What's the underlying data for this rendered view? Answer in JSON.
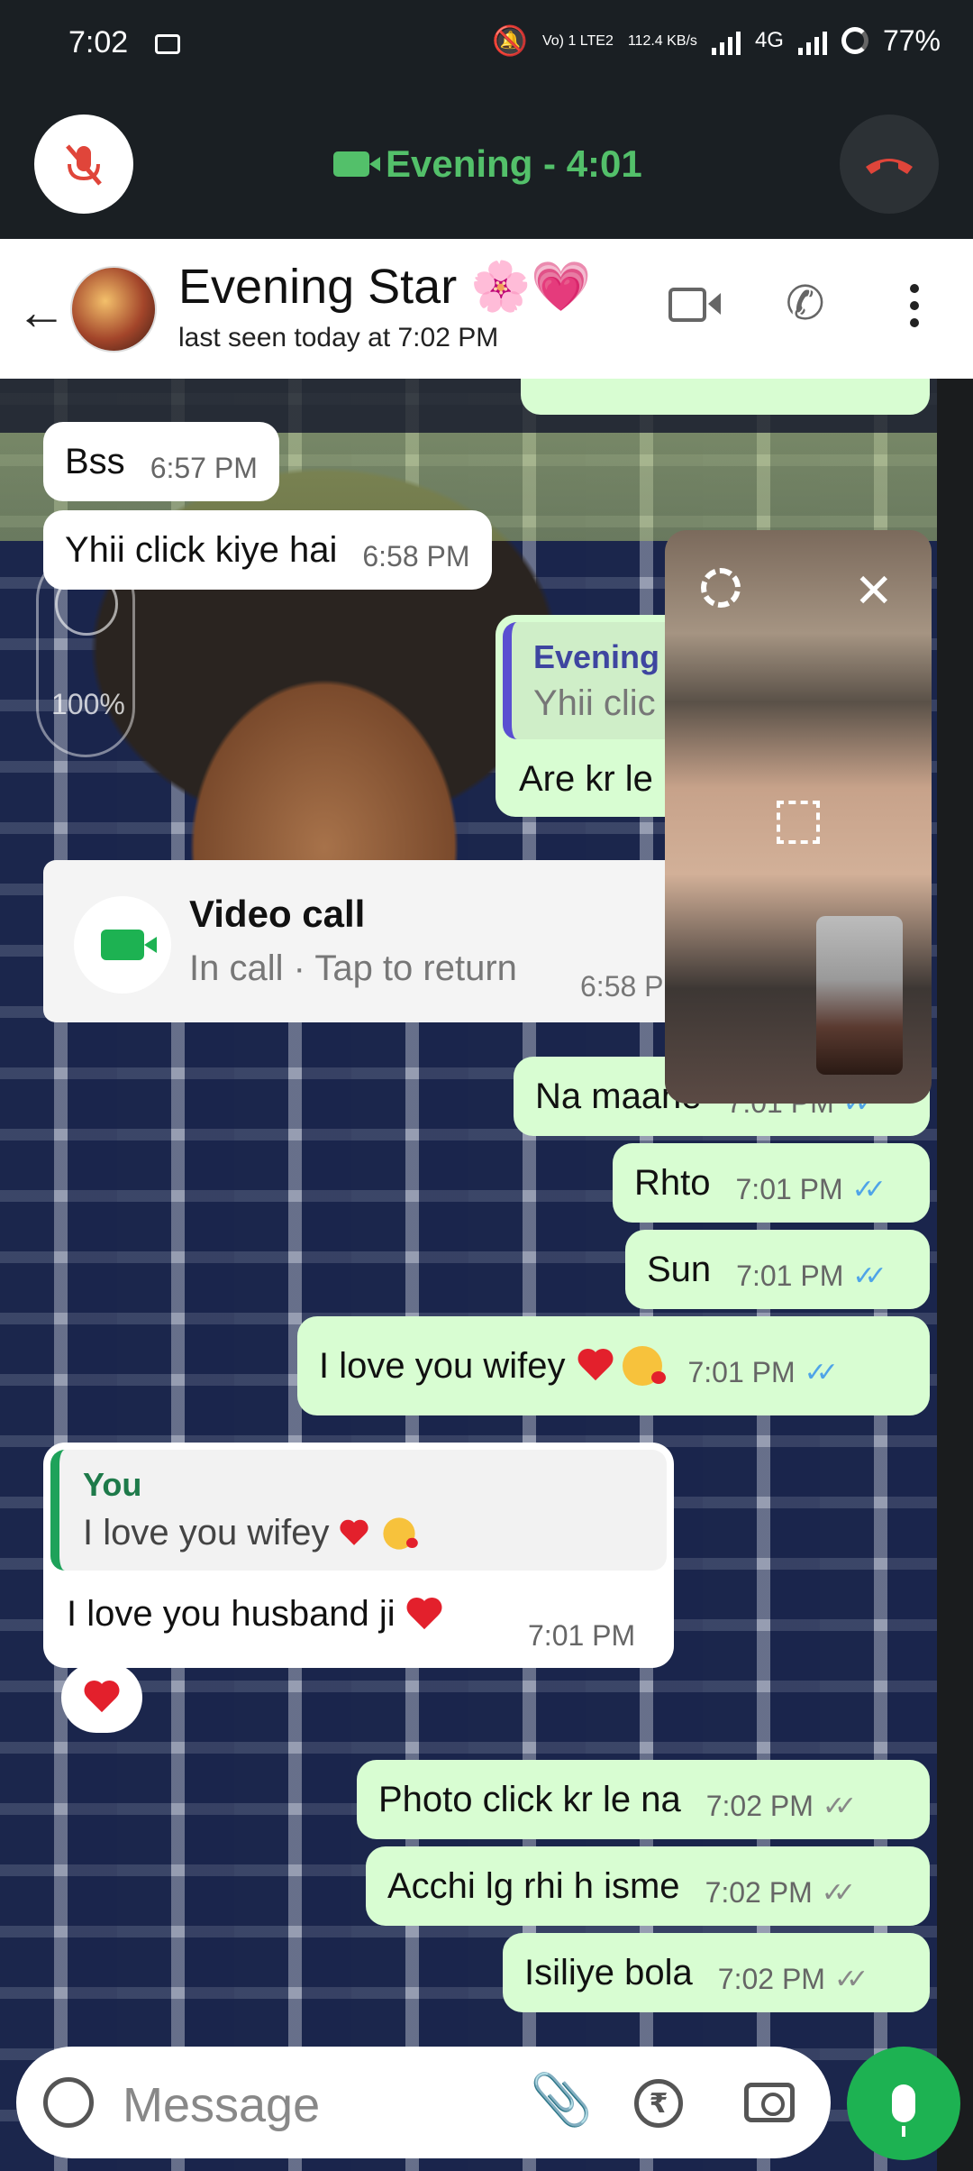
{
  "status_bar": {
    "time": "7:02",
    "volte": "Vo) 1 LTE2",
    "speed": "112.4 KB/s",
    "network": "4G",
    "battery": "77%"
  },
  "call_bar": {
    "title": "Evening - 4:01",
    "accent_color": "#53c06a",
    "end_color": "#e0453a"
  },
  "header": {
    "contact_name": "Evening Star 🌸💗",
    "last_seen": "last seen today at 7:02 PM"
  },
  "messages": [
    {
      "dir": "in",
      "text": "Bss",
      "time": "6:57 PM"
    },
    {
      "dir": "in",
      "text": "Yhii click kiye hai",
      "time": "6:58 PM"
    },
    {
      "dir": "out",
      "quote_name": "Evening",
      "quote_text": "Yhii clic",
      "text": "Are kr le"
    },
    {
      "dir": "out",
      "text": "Na maane",
      "time": "7:01 PM"
    },
    {
      "dir": "out",
      "text": "Rhto",
      "time": "7:01 PM"
    },
    {
      "dir": "out",
      "text": "Sun",
      "time": "7:01 PM"
    },
    {
      "dir": "out",
      "text": "I love you wifey",
      "time": "7:01 PM"
    },
    {
      "dir": "out",
      "text": "Photo click kr le na",
      "time": "7:02 PM"
    },
    {
      "dir": "out",
      "text": "Acchi lg rhi h isme",
      "time": "7:02 PM"
    },
    {
      "dir": "out",
      "text": "Isiliye bola",
      "time": "7:02 PM"
    }
  ],
  "video_call_card": {
    "title": "Video call",
    "subtitle": "In call · Tap to return",
    "time": "6:58 PM"
  },
  "reply_message": {
    "quote_name": "You",
    "quote_text": "I love you wifey",
    "text": "I love you husband ji",
    "time": "7:01 PM"
  },
  "zoom_overlay": {
    "percent": "100%"
  },
  "input": {
    "placeholder": "Message"
  },
  "icons": [
    "mic-off-icon",
    "video-camera-icon",
    "end-call-icon",
    "back-arrow-icon",
    "phone-icon",
    "more-vert-icon",
    "settings-icon",
    "close-icon",
    "fullscreen-icon",
    "emoji-icon",
    "attach-icon",
    "rupee-icon",
    "camera-icon",
    "mic-icon"
  ]
}
